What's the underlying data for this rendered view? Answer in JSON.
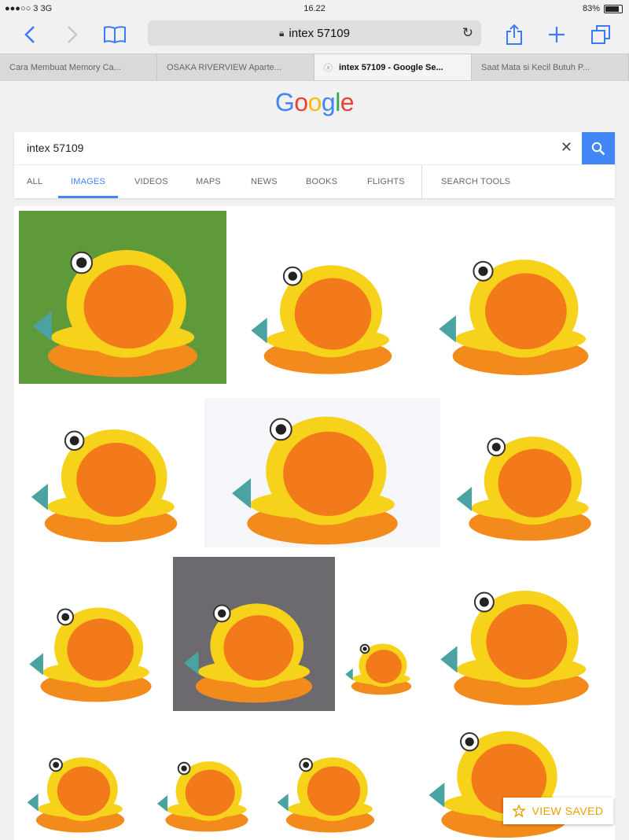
{
  "status": {
    "carrier": "●●●○○ 3  3G",
    "time": "16.22",
    "battery": "83%",
    "battery_level": 0.83
  },
  "toolbar": {
    "url": "intex 57109"
  },
  "tabs": [
    {
      "title": "Cara Membuat Memory Ca..."
    },
    {
      "title": "OSAKA RIVERVIEW Aparte..."
    },
    {
      "title": "intex 57109 - Google Se...",
      "active": true
    },
    {
      "title": "Saat Mata si Kecil Butuh P..."
    }
  ],
  "logo": {
    "text": "Google",
    "colors": [
      "#4285F4",
      "#EA4335",
      "#FBBC05",
      "#4285F4",
      "#34A853",
      "#EA4335"
    ]
  },
  "search": {
    "query": "intex 57109"
  },
  "nav": [
    {
      "label": "ALL"
    },
    {
      "label": "IMAGES",
      "active": true
    },
    {
      "label": "VIDEOS"
    },
    {
      "label": "MAPS"
    },
    {
      "label": "NEWS"
    },
    {
      "label": "BOOKS"
    },
    {
      "label": "FLIGHTS"
    },
    {
      "label": "SEARCH TOOLS"
    }
  ],
  "results": [
    {
      "bg": "#5f9a3a"
    },
    {
      "bg": "#ffffff"
    },
    {
      "bg": "#ffffff"
    },
    {
      "bg": "#ffffff"
    },
    {
      "bg": "#f4f6fa"
    },
    {
      "bg": "#ffffff"
    },
    {
      "bg": "#ffffff"
    },
    {
      "bg": "#6c6a6e"
    },
    {
      "bg": "#ffffff"
    },
    {
      "bg": "#ffffff"
    },
    {
      "bg": "#ffffff"
    },
    {
      "bg": "#ffffff"
    },
    {
      "bg": "#ffffff"
    },
    {
      "bg": "#ffffff"
    },
    {
      "bg": "#cfcfd4"
    }
  ],
  "view_saved": {
    "label": "VIEW SAVED"
  },
  "colors": {
    "accent": "#4285f4",
    "ios_blue": "#3b7bf7",
    "pool_orange": "#f38a1c",
    "pool_yellow": "#f6d21b"
  }
}
